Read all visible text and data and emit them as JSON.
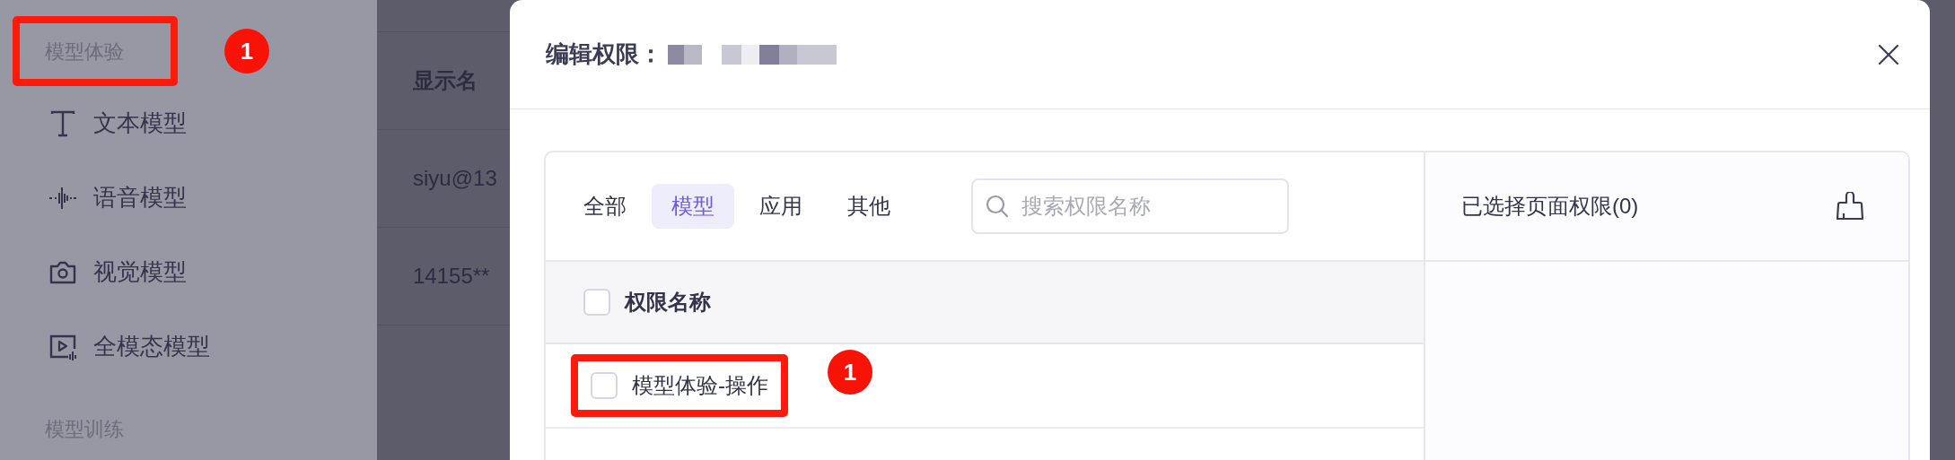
{
  "sidebar": {
    "sections": [
      {
        "heading": "模型体验",
        "annotation": "1",
        "items": [
          {
            "label": "文本模型"
          },
          {
            "label": "语音模型"
          },
          {
            "label": "视觉模型"
          },
          {
            "label": "全模态模型"
          }
        ]
      },
      {
        "heading": "模型训练"
      }
    ]
  },
  "background_table": {
    "column_header": "显示名",
    "cells": [
      "siyu@13",
      "14155**"
    ]
  },
  "modal": {
    "title": "编辑权限：",
    "tabs": [
      {
        "label": "全部",
        "selected": false
      },
      {
        "label": "模型",
        "selected": true
      },
      {
        "label": "应用",
        "selected": false
      },
      {
        "label": "其他",
        "selected": false
      }
    ],
    "search": {
      "placeholder": "搜索权限名称"
    },
    "table": {
      "header": "权限名称",
      "header_checked": false,
      "rows": [
        {
          "label": "模型体验-操作",
          "checked": false,
          "annotation": "1"
        }
      ]
    },
    "selected_panel": {
      "title": "已选择页面权限(0)"
    }
  }
}
